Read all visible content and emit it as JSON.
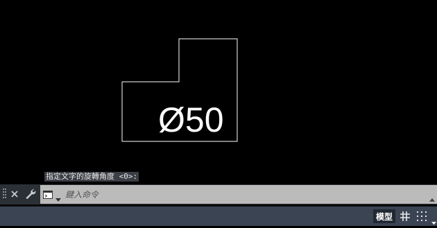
{
  "canvas": {
    "dimension_text": "Ø50",
    "background": "#000000",
    "line_color": "#ffffff"
  },
  "command_prompt": {
    "tooltip_text": "指定文字的旋轉角度 <0>:"
  },
  "command_line": {
    "placeholder": "鍵入命令",
    "icons": {
      "grip": "drag-handle-icon",
      "close": "close-icon",
      "customize": "wrench-icon",
      "recent_commands": "command-prompt-icon",
      "dropdown": "chevron-down-icon",
      "history": "chevron-up-icon"
    }
  },
  "status_bar": {
    "model_label": "模型",
    "icons": [
      "grid-icon",
      "snap-icon",
      "chevron-down-icon"
    ]
  },
  "colors": {
    "command_bar": "#2b2f36",
    "command_input": "#bbbbbb",
    "status_bar": "#3b4453",
    "model_button": "#222831"
  }
}
